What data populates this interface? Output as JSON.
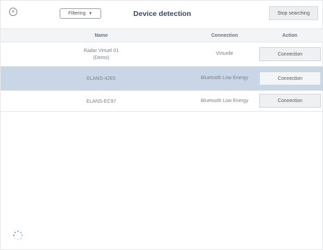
{
  "header": {
    "close_glyph": "×",
    "filter_label": "Filtering",
    "filter_caret": "▼",
    "title": "Device detection",
    "stop_label": "Stop searching"
  },
  "table": {
    "columns": {
      "name": "Name",
      "connection": "Connection",
      "action": "Action"
    },
    "rows": [
      {
        "name_line1": "Radar Virtuel 01",
        "name_line2": "(Demo)",
        "connection": "Virtuelle",
        "action": "Connection",
        "selected": false
      },
      {
        "name_line1": "ELANS-42E5",
        "name_line2": "",
        "connection": "Bluetooth Low Energy",
        "action": "Connection",
        "selected": true
      },
      {
        "name_line1": "ELANS-EC97",
        "name_line2": "",
        "connection": "Bluetooth Low Energy",
        "action": "Connection",
        "selected": false
      }
    ]
  },
  "colors": {
    "selected_row": "#c8d6e5",
    "title_text": "#3c4a5a"
  },
  "icons": {
    "close": "close-icon",
    "spinner": "loading-spinner-icon"
  }
}
